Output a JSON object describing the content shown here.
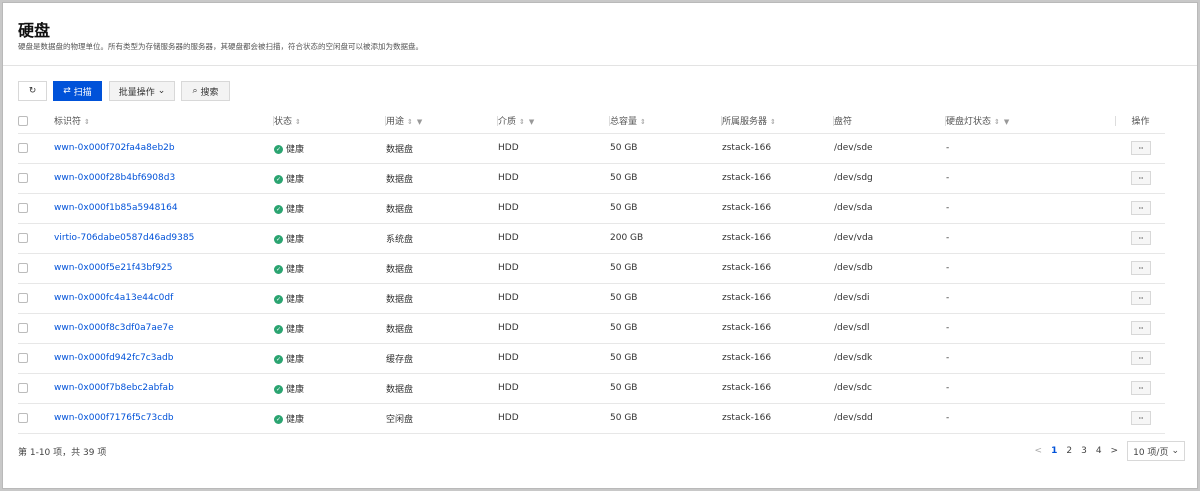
{
  "page": {
    "title": "硬盘",
    "description": "硬盘是数据盘的物理单位。所有类型为存储服务器的服务器，其硬盘都会被扫描，符合状态的空闲盘可以被添加为数据盘。"
  },
  "toolbar": {
    "refresh_icon": "refresh-icon",
    "scan_label": "扫描",
    "batch_label": "批量操作",
    "search_label": "搜索"
  },
  "table": {
    "columns": [
      "标识符",
      "状态",
      "用途",
      "介质",
      "总容量",
      "所属服务器",
      "盘符",
      "硬盘灯状态",
      "操作"
    ],
    "rows": [
      {
        "id": "wwn-0x000f702fa4a8eb2b",
        "status": "健康",
        "usage": "数据盘",
        "media": "HDD",
        "capacity": "50 GB",
        "server": "zstack-166",
        "drive": "/dev/sde",
        "light": "-"
      },
      {
        "id": "wwn-0x000f28b4bf6908d3",
        "status": "健康",
        "usage": "数据盘",
        "media": "HDD",
        "capacity": "50 GB",
        "server": "zstack-166",
        "drive": "/dev/sdg",
        "light": "-"
      },
      {
        "id": "wwn-0x000f1b85a5948164",
        "status": "健康",
        "usage": "数据盘",
        "media": "HDD",
        "capacity": "50 GB",
        "server": "zstack-166",
        "drive": "/dev/sda",
        "light": "-"
      },
      {
        "id": "virtio-706dabe0587d46ad9385",
        "status": "健康",
        "usage": "系统盘",
        "media": "HDD",
        "capacity": "200 GB",
        "server": "zstack-166",
        "drive": "/dev/vda",
        "light": "-"
      },
      {
        "id": "wwn-0x000f5e21f43bf925",
        "status": "健康",
        "usage": "数据盘",
        "media": "HDD",
        "capacity": "50 GB",
        "server": "zstack-166",
        "drive": "/dev/sdb",
        "light": "-"
      },
      {
        "id": "wwn-0x000fc4a13e44c0df",
        "status": "健康",
        "usage": "数据盘",
        "media": "HDD",
        "capacity": "50 GB",
        "server": "zstack-166",
        "drive": "/dev/sdi",
        "light": "-"
      },
      {
        "id": "wwn-0x000f8c3df0a7ae7e",
        "status": "健康",
        "usage": "数据盘",
        "media": "HDD",
        "capacity": "50 GB",
        "server": "zstack-166",
        "drive": "/dev/sdl",
        "light": "-"
      },
      {
        "id": "wwn-0x000fd942fc7c3adb",
        "status": "健康",
        "usage": "缓存盘",
        "media": "HDD",
        "capacity": "50 GB",
        "server": "zstack-166",
        "drive": "/dev/sdk",
        "light": "-"
      },
      {
        "id": "wwn-0x000f7b8ebc2abfab",
        "status": "健康",
        "usage": "数据盘",
        "media": "HDD",
        "capacity": "50 GB",
        "server": "zstack-166",
        "drive": "/dev/sdc",
        "light": "-"
      },
      {
        "id": "wwn-0x000f7176f5c73cdb",
        "status": "健康",
        "usage": "空闲盘",
        "media": "HDD",
        "capacity": "50 GB",
        "server": "zstack-166",
        "drive": "/dev/sdd",
        "light": "-"
      }
    ],
    "more_label": "···"
  },
  "footer": {
    "total": "第 1-10 项，共 39 项",
    "pages": [
      "1",
      "2",
      "3",
      "4"
    ],
    "current_page": "1",
    "page_size": "10 项/页",
    "prev_symbol": "<",
    "next_symbol": ">"
  },
  "colors": {
    "primary": "#0052d9",
    "success": "#2ba471"
  }
}
